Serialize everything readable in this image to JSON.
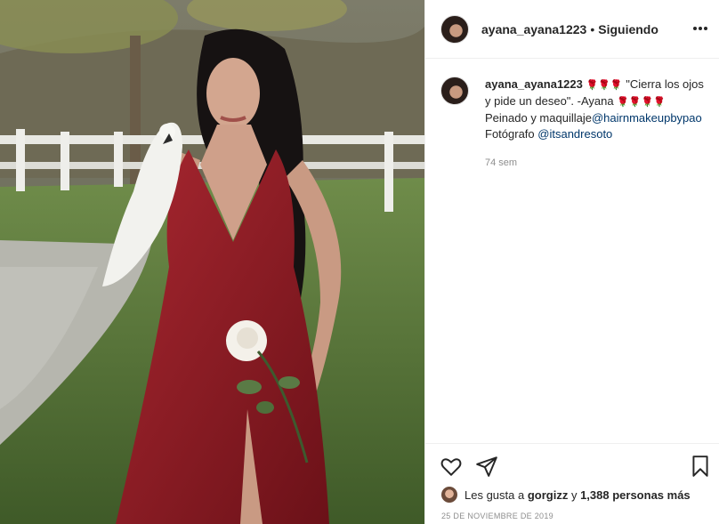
{
  "post": {
    "username": "ayana_ayana1223",
    "separator": "•",
    "follow_status": "Siguiendo",
    "more_icon": "more-horizontal-icon"
  },
  "caption": {
    "username": "ayana_ayana1223",
    "roses_start": "🌹🌹🌹",
    "text": " \"Cierra los ojos y pide un deseo\". -Ayana ",
    "roses_end": "🌹🌹🌹🌹",
    "line2_prefix": "Peinado y maquillaje",
    "mention1": "@hairnmakeupbypao",
    "line3_prefix": "Fotógrafo ",
    "mention2": "@itsandresoto",
    "time": "74 sem"
  },
  "actions": {
    "like_icon": "heart-icon",
    "share_icon": "send-icon",
    "save_icon": "bookmark-icon"
  },
  "likes": {
    "prefix": "Les gusta a ",
    "user": "gorgizz",
    "middle": " y ",
    "count": "1,388 personas más"
  },
  "date": "25 DE NOVIEMBRE DE 2019",
  "colors": {
    "rose": "#c0201c",
    "mention": "#00376b",
    "muted": "#8e8e8e",
    "dress": "#8b1a1f"
  }
}
